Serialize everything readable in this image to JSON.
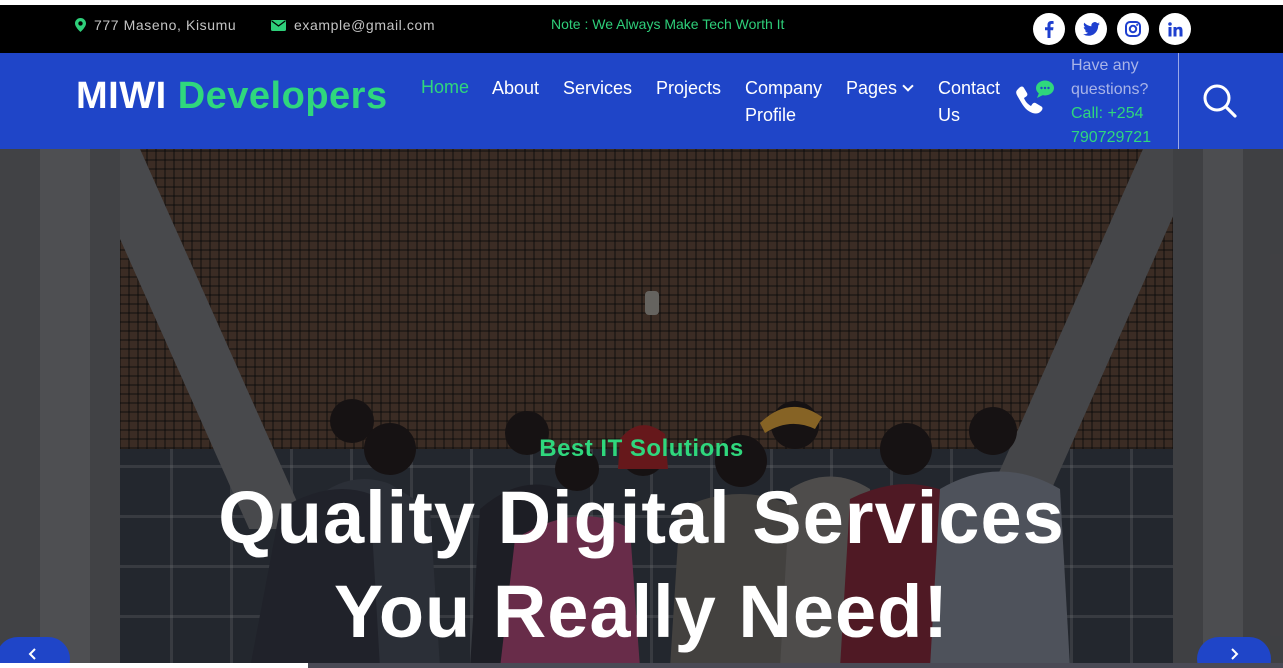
{
  "topbar": {
    "address": "777 Maseno, Kisumu",
    "email": "example@gmail.com",
    "note": "Note : We Always Make Tech Worth It",
    "socials": [
      {
        "name": "facebook",
        "glyph": "f"
      },
      {
        "name": "twitter",
        "glyph": "t"
      },
      {
        "name": "instagram",
        "glyph": "◎"
      },
      {
        "name": "linkedin",
        "glyph": "in"
      }
    ]
  },
  "brand": {
    "part1": "MIWI",
    "part2": "Developers"
  },
  "nav": {
    "home": "Home",
    "about": "About",
    "services": "Services",
    "projects": "Projects",
    "company_line1": "Company",
    "company_line2": "Profile",
    "pages": "Pages",
    "contact_line1": "Contact",
    "contact_line2": "Us"
  },
  "call": {
    "line1": "Have any",
    "line2": "questions?",
    "line3": "Call: +254",
    "line4": "790729721"
  },
  "hero": {
    "subtitle": "Best IT Solutions",
    "title_line1": "Quality Digital Services",
    "title_line2": "You Really Need!"
  },
  "slider": {
    "progress": 0.24
  },
  "colors": {
    "accent": "#2fd77d",
    "brand_blue": "#1f45c8",
    "topbar_bg": "#000000"
  }
}
